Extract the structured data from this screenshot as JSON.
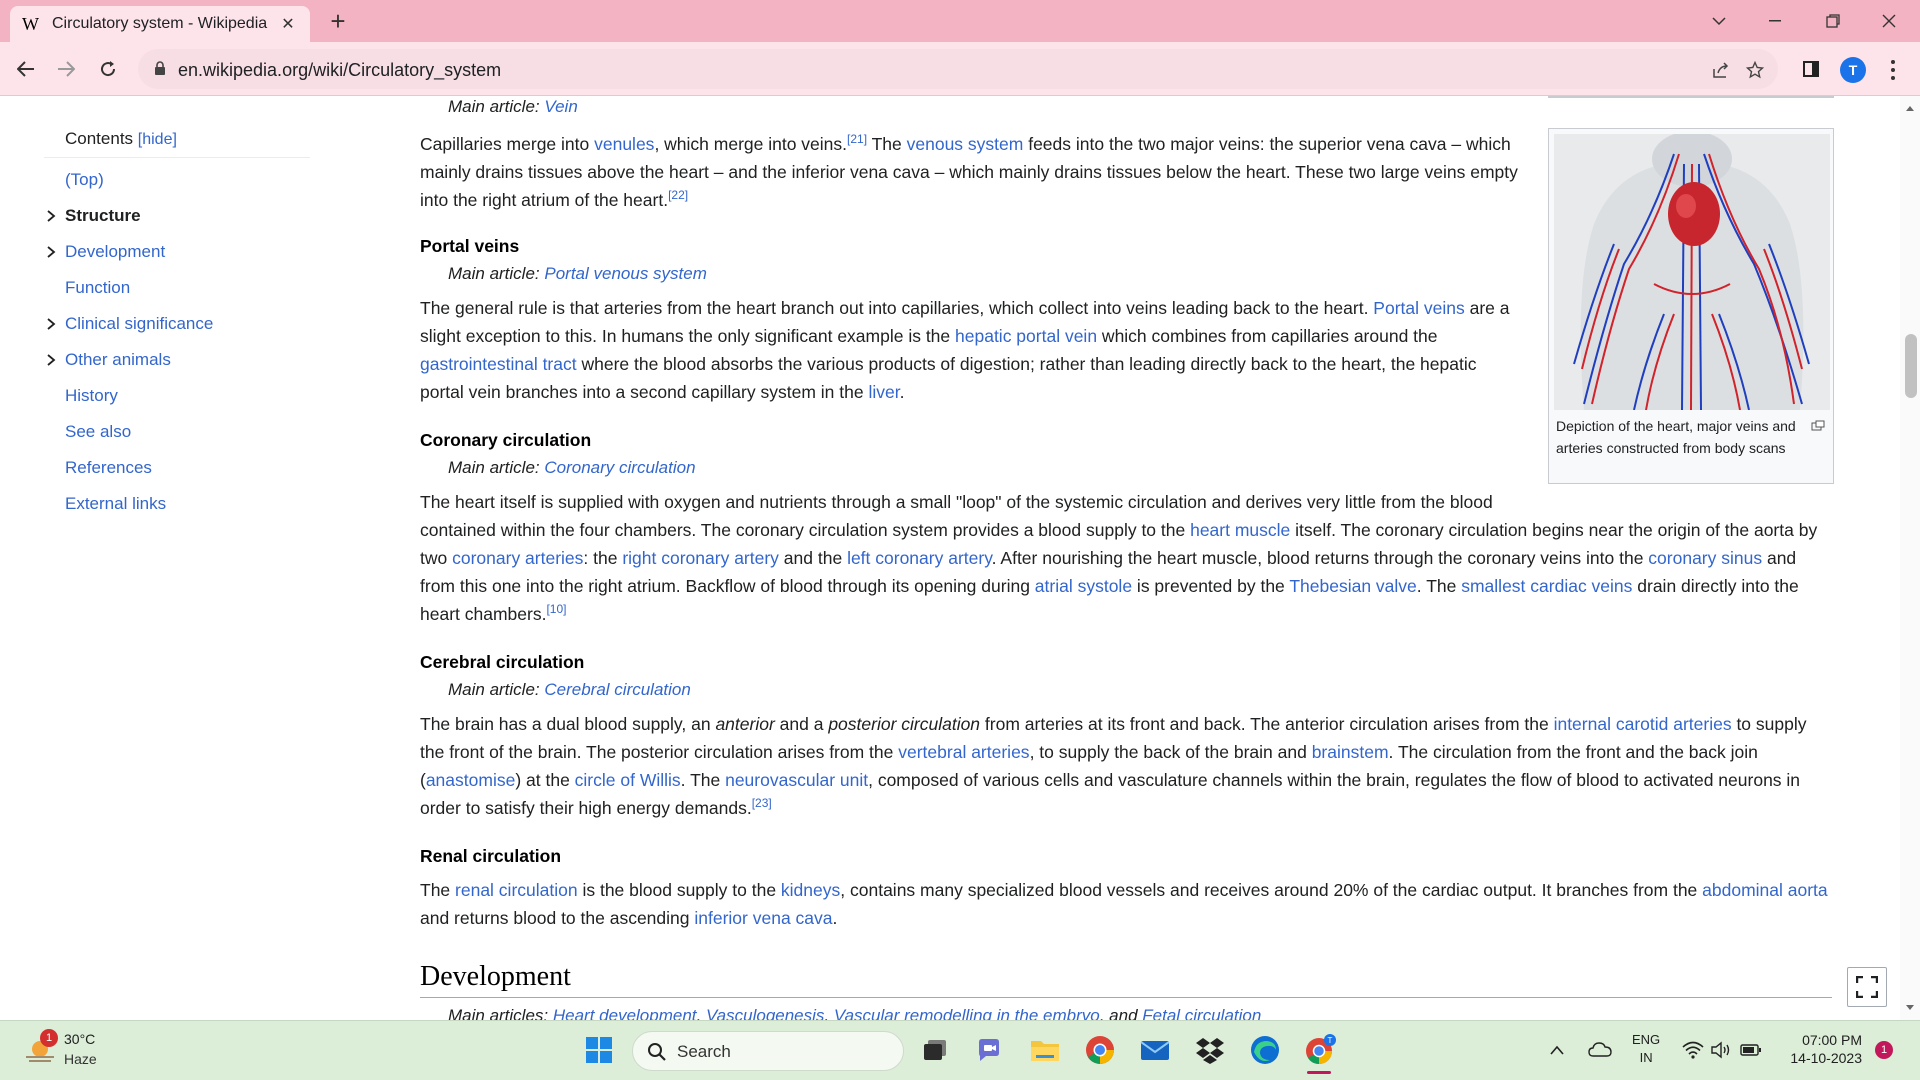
{
  "browser": {
    "tab_title": "Circulatory system - Wikipedia",
    "tab_favicon": "W",
    "url": "en.wikipedia.org/wiki/Circulatory_system",
    "profile_initial": "T"
  },
  "toc": {
    "heading": "Contents",
    "hide_label": "[hide]",
    "items": [
      {
        "label": "(Top)",
        "expandable": false,
        "active": false
      },
      {
        "label": "Structure",
        "expandable": true,
        "active": true
      },
      {
        "label": "Development",
        "expandable": true,
        "active": false
      },
      {
        "label": "Function",
        "expandable": false,
        "active": false
      },
      {
        "label": "Clinical significance",
        "expandable": true,
        "active": false
      },
      {
        "label": "Other animals",
        "expandable": true,
        "active": false
      },
      {
        "label": "History",
        "expandable": false,
        "active": false
      },
      {
        "label": "See also",
        "expandable": false,
        "active": false
      },
      {
        "label": "References",
        "expandable": false,
        "active": false
      },
      {
        "label": "External links",
        "expandable": false,
        "active": false
      }
    ]
  },
  "article": {
    "vein_hatnote": {
      "prefix": "Main article: ",
      "link": "Vein"
    },
    "veins_para": {
      "l1_a": "Capillaries merge into ",
      "l1_link1": "venules",
      "l1_b": ", which merge into veins.",
      "l1_ref1": "[21]",
      "l1_c": " The ",
      "l1_link2": "venous system",
      "l1_d": " feeds into the two major veins: the superior vena cava – which",
      "l2": "mainly drains tissues above the heart – and the inferior vena cava – which mainly drains tissues below the heart. These two large veins empty",
      "l3": "into the right atrium of the heart.",
      "l3_ref": "[22]"
    },
    "portal": {
      "heading": "Portal veins",
      "hatnote_prefix": "Main article: ",
      "hatnote_link": "Portal venous system",
      "l1_a": "The general rule is that arteries from the heart branch out into capillaries, which collect into veins leading back to the heart. ",
      "l1_link": "Portal veins",
      "l1_b": " are a",
      "l2_a": "slight exception to this. In humans the only significant example is the ",
      "l2_link": "hepatic portal vein",
      "l2_b": " which combines from capillaries around the",
      "l3_link": "gastrointestinal tract",
      "l3_b": " where the blood absorbs the various products of digestion; rather than leading directly back to the heart, the hepatic",
      "l4_a": "portal vein branches into a second capillary system in the ",
      "l4_link": "liver",
      "l4_b": "."
    },
    "coronary": {
      "heading": "Coronary circulation",
      "hatnote_prefix": "Main article: ",
      "hatnote_link": "Coronary circulation",
      "l1": "The heart itself is supplied with oxygen and nutrients through a small \"loop\" of the systemic circulation and derives very little from the blood",
      "l2_a": "contained within the four chambers. The coronary circulation system provides a blood supply to the ",
      "l2_link": "heart muscle",
      "l2_b": " itself. The coronary circulation begins near the origin of the aorta by",
      "l3_a": "two ",
      "l3_link1": "coronary arteries",
      "l3_b": ": the ",
      "l3_link2": "right coronary artery",
      "l3_c": " and the ",
      "l3_link3": "left coronary artery",
      "l3_d": ". After nourishing the heart muscle, blood returns through the coronary veins into the ",
      "l3_link4": "coronary sinus",
      "l3_e": " and",
      "l4_a": "from this one into the right atrium. Backflow of blood through its opening during ",
      "l4_link1": "atrial systole",
      "l4_b": " is prevented by the ",
      "l4_link2": "Thebesian valve",
      "l4_c": ". The ",
      "l4_link3": "smallest cardiac veins",
      "l4_d": " drain directly into the",
      "l5": "heart chambers.",
      "l5_ref": "[10]"
    },
    "cerebral": {
      "heading": "Cerebral circulation",
      "hatnote_prefix": "Main article: ",
      "hatnote_link": "Cerebral circulation",
      "l1_a": "The brain has a dual blood supply, an ",
      "l1_em1": "anterior",
      "l1_b": " and a ",
      "l1_em2": "posterior circulation",
      "l1_c": " from arteries at its front and back. The anterior circulation arises from the ",
      "l1_link": "internal carotid arteries",
      "l1_d": " to supply",
      "l2_a": "the front of the brain. The posterior circulation arises from the ",
      "l2_link1": "vertebral arteries",
      "l2_b": ", to supply the back of the brain and ",
      "l2_link2": "brainstem",
      "l2_c": ". The circulation from the front and the back join",
      "l3_a": "(",
      "l3_link1": "anastomise",
      "l3_b": ") at the ",
      "l3_link2": "circle of Willis",
      "l3_c": ". The ",
      "l3_link3": "neurovascular unit",
      "l3_d": ", composed of various cells and vasculature channels within the brain, regulates the flow of blood to activated neurons in",
      "l4": "order to satisfy their high energy demands.",
      "l4_ref": "[23]"
    },
    "renal": {
      "heading": "Renal circulation",
      "l1_a": "The ",
      "l1_link1": "renal circulation",
      "l1_b": " is the blood supply to the ",
      "l1_link2": "kidneys",
      "l1_c": ", contains many specialized blood vessels and receives around 20% of the cardiac output. It branches from the ",
      "l1_link3": "abdominal aorta",
      "l2_a": "and returns blood to the ascending ",
      "l2_link": "inferior vena cava",
      "l2_b": "."
    },
    "development_heading": "Development",
    "development_hatnote": {
      "prefix": "Main articles: ",
      "link1": "Heart development",
      "link2": "Vasculogenesis",
      "link3": "Vascular remodelling in the embryo",
      "sep": ", ",
      "and": ", and ",
      "link4": "Fetal circulation"
    },
    "figure_caption": "Depiction of the heart, major veins and arteries constructed from body scans"
  },
  "taskbar": {
    "temperature": "30°C",
    "weather": "Haze",
    "weather_badge": "1",
    "search_label": "Search",
    "lang_line1": "ENG",
    "lang_line2": "IN",
    "time": "07:00 PM",
    "date": "14-10-2023",
    "notification_count": "1"
  },
  "colors": {
    "link": "#3366cc",
    "titlebar": "#f4b3c2",
    "toolbar": "#fde4ea",
    "taskbar": "#dcedd8"
  }
}
